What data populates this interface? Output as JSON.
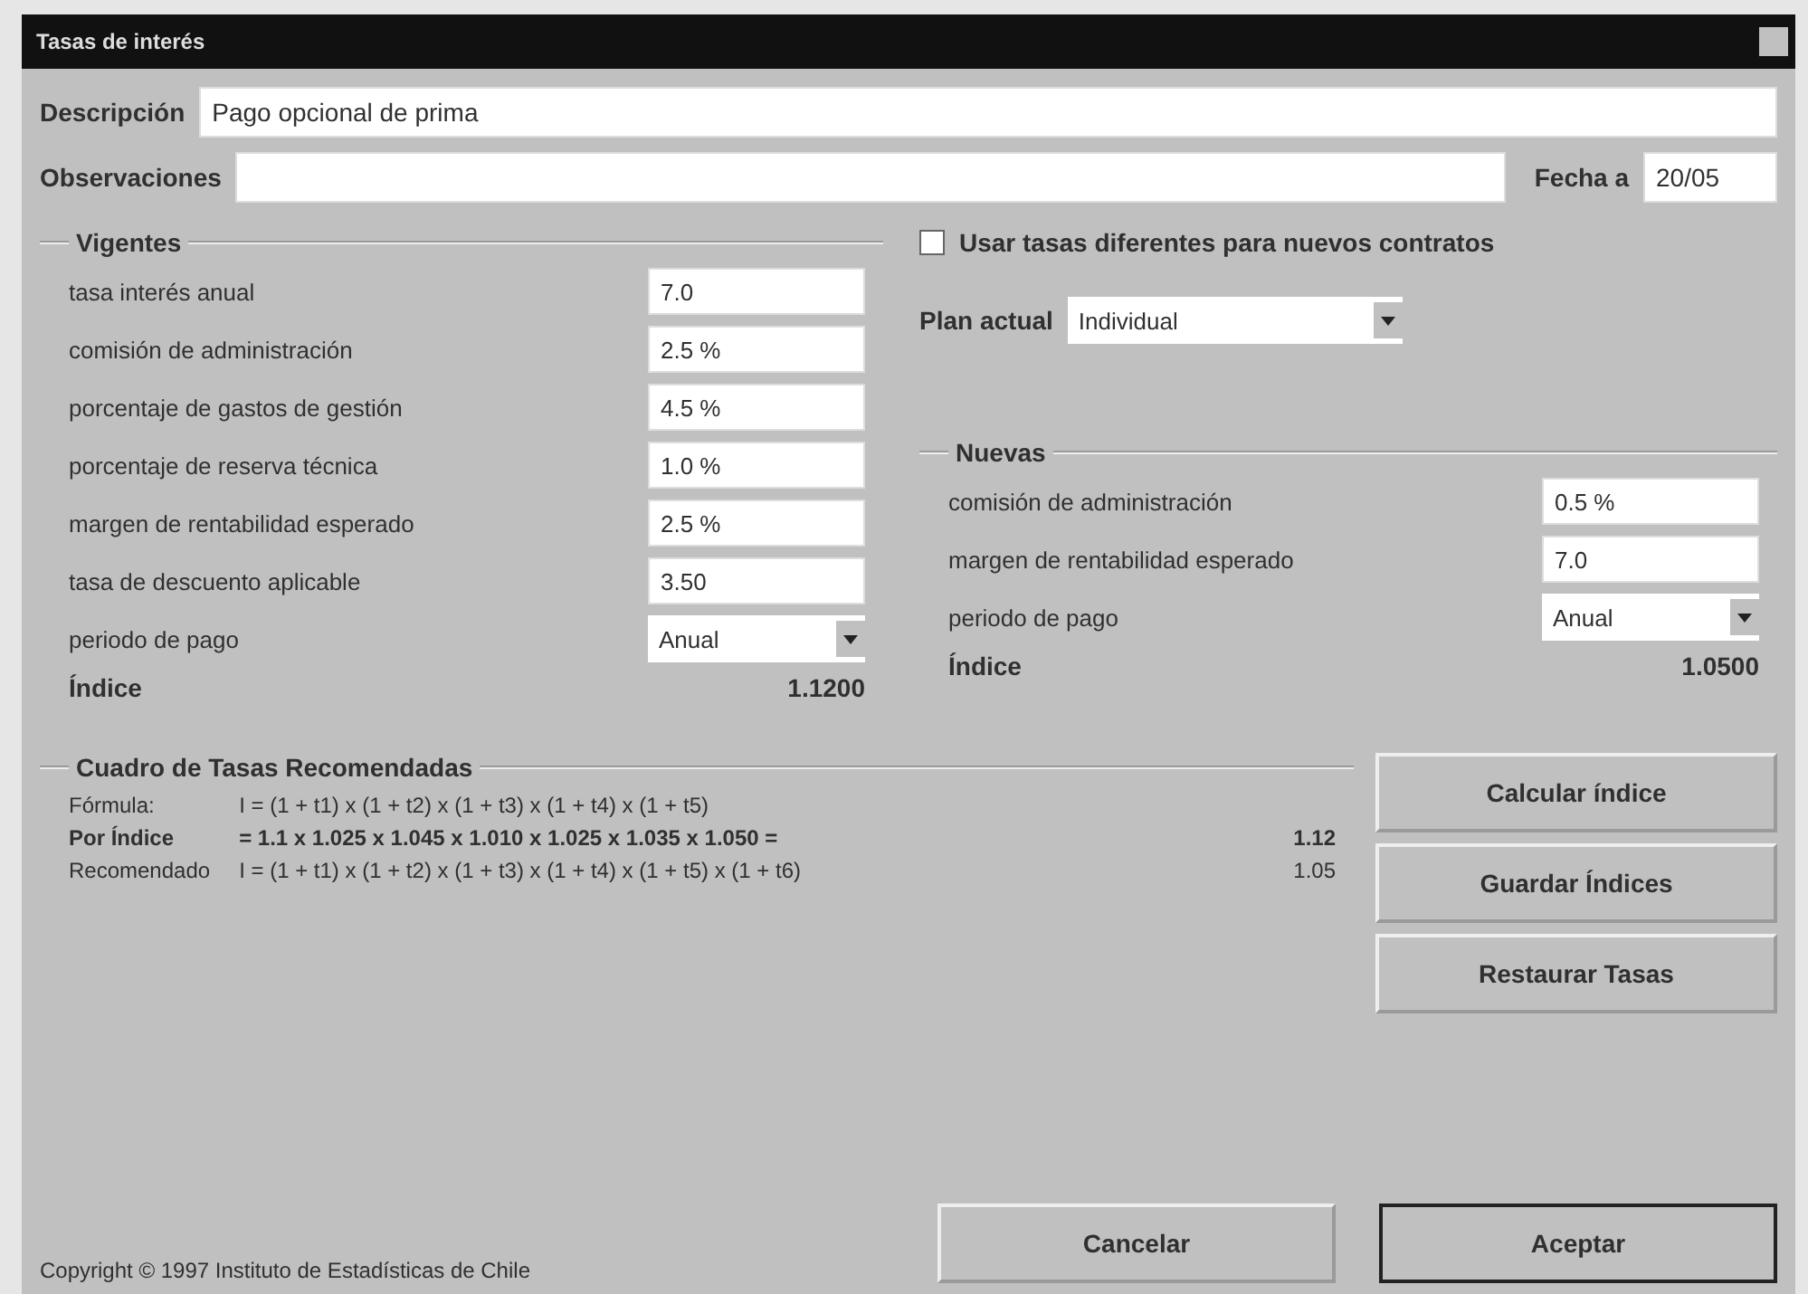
{
  "window": {
    "title": "Tasas de interés"
  },
  "description": {
    "label": "Descripción",
    "value": "Pago opcional de prima"
  },
  "notes": {
    "label": "Observaciones"
  },
  "date": {
    "label": "Fecha a",
    "value": "20/05"
  },
  "current": {
    "title": "Vigentes",
    "rows": [
      {
        "kind": "field",
        "label": "tasa interés anual",
        "value": "7.0"
      },
      {
        "kind": "field",
        "label": "comisión de administración",
        "value": "2.5 %"
      },
      {
        "kind": "field",
        "label": "porcentaje de gastos de gestión",
        "value": "4.5 %"
      },
      {
        "kind": "field",
        "label": "porcentaje de reserva técnica",
        "value": "1.0 %"
      },
      {
        "kind": "field",
        "label": "margen de rentabilidad esperado",
        "value": "2.5 %"
      },
      {
        "kind": "field",
        "label": "tasa de descuento aplicable",
        "value": "3.50"
      },
      {
        "kind": "select",
        "label": "periodo de pago",
        "value": "Anual"
      }
    ],
    "index_label": "Índice",
    "index_value": "1.1200"
  },
  "use_different": {
    "label": "Usar tasas diferentes para nuevos contratos",
    "checked": false
  },
  "plan": {
    "label": "Plan actual",
    "value": "Individual"
  },
  "new": {
    "title": "Nuevas",
    "rows": [
      {
        "kind": "field",
        "label": "comisión de administración",
        "value": "0.5 %"
      },
      {
        "kind": "field",
        "label": "margen de rentabilidad esperado",
        "value": "7.0"
      },
      {
        "kind": "select",
        "label": "periodo de pago",
        "value": "Anual"
      }
    ],
    "index_label": "Índice",
    "index_value": "1.0500"
  },
  "recommended": {
    "title": "Cuadro de Tasas Recomendadas",
    "lines": [
      {
        "label": "Fórmula:",
        "text": "I = (1 + t1) x (1 + t2) x (1 + t3) x (1 + t4) x (1 + t5)",
        "bold": false
      },
      {
        "label": "Por Índice",
        "text": "= 1.1 x 1.025 x 1.045 x 1.010 x 1.025 x 1.035 x 1.050 =",
        "result": "1.12",
        "bold": true
      },
      {
        "label": "Recomendado",
        "text": "I = (1 + t1) x (1 + t2) x (1 + t3) x (1 + t4) x (1 + t5) x (1 + t6)",
        "result": "1.05",
        "bold": false
      }
    ]
  },
  "side_buttons": [
    "Calcular índice",
    "Guardar Índices",
    "Restaurar Tasas"
  ],
  "cancel": "Cancelar",
  "accept": "Aceptar",
  "footer": "Copyright © 1997 Instituto de Estadísticas de Chile"
}
